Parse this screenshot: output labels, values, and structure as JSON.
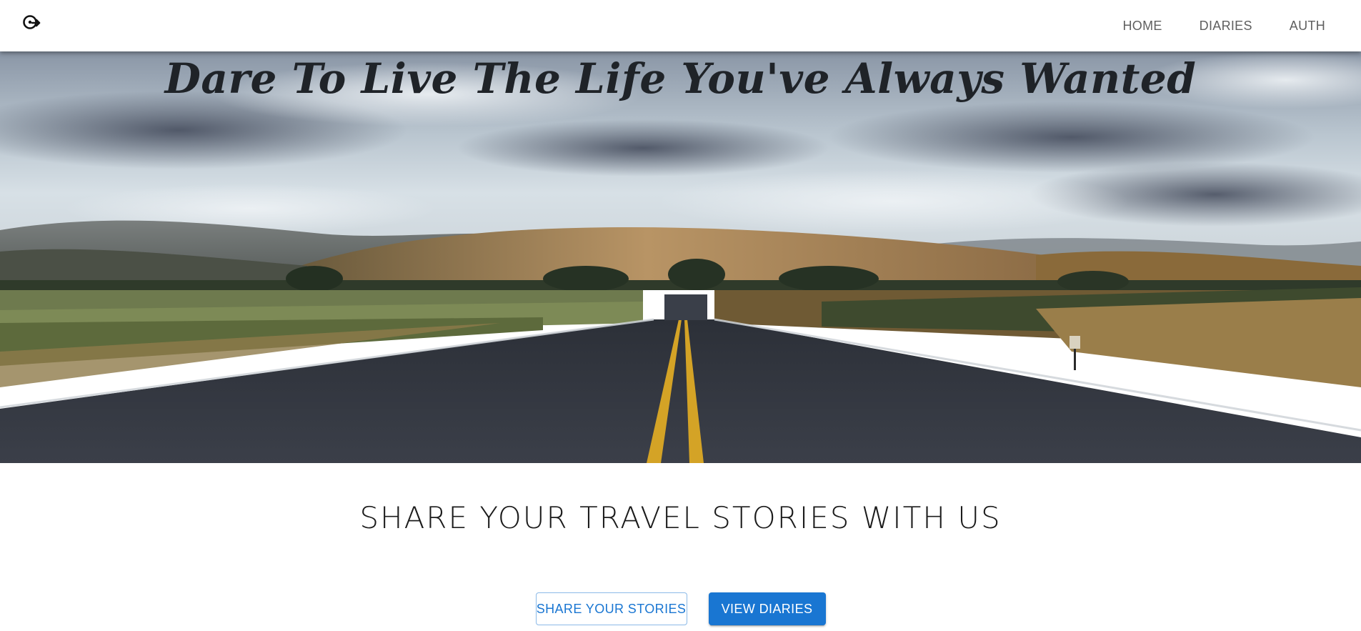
{
  "appbar": {
    "logo_icon": "travel-explore-icon",
    "nav": [
      {
        "label": "HOME"
      },
      {
        "label": "DIARIES"
      },
      {
        "label": "AUTH"
      }
    ]
  },
  "hero": {
    "title": "Dare To Live The Life You've Always Wanted",
    "image": "open-road-landscape"
  },
  "main": {
    "tagline": "SHARE YOUR TRAVEL STORIES WITH US",
    "buttons": {
      "share_label": "SHARE YOUR STORIES",
      "view_label": "VIEW DIARIES"
    }
  },
  "colors": {
    "primary": "#1976d2",
    "nav_text": "#5f5f5f",
    "title_text": "#1f2328"
  }
}
